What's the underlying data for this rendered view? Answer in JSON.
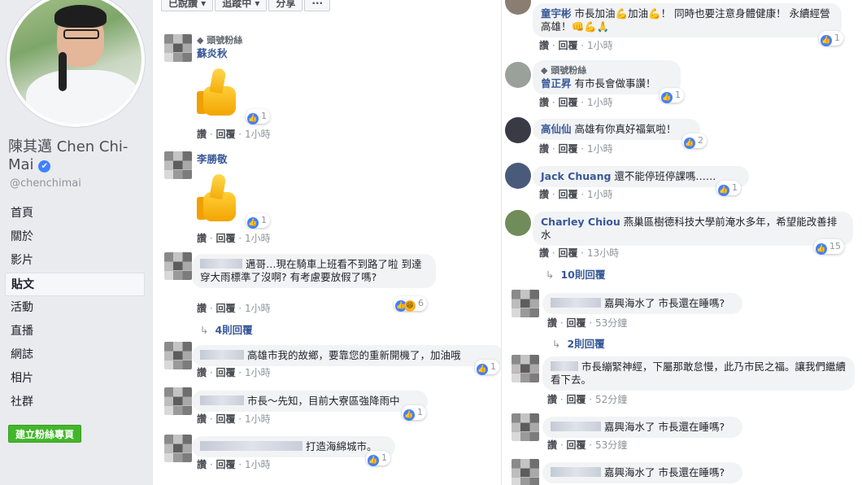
{
  "profile": {
    "name": "陳其邁 Chen Chi-Mai",
    "handle": "@chenchimai",
    "nav": [
      "首頁",
      "關於",
      "影片",
      "貼文",
      "活動",
      "直播",
      "網誌",
      "相片",
      "社群"
    ],
    "active_nav": "貼文",
    "create_page_label": "建立粉絲專頁"
  },
  "post_actions": [
    "已說讚 ▾",
    "追蹤中 ▾",
    "分享",
    "···"
  ],
  "labels": {
    "like": "讚",
    "reply": "回覆"
  },
  "left_comments": [
    {
      "badge": "頭號粉絲",
      "author": "蘇炎秋",
      "text": "",
      "sticker": true,
      "reactions": "1",
      "time": "1小時"
    },
    {
      "badge": "",
      "author": "李勝敬",
      "text": "",
      "sticker": true,
      "reactions": "1",
      "time": "1小時"
    },
    {
      "badge": "",
      "author": "",
      "text": "邁哥…現在騎車上班看不到路了啦 到達穿大雨標準了沒啊? 有考慮要放假了嗎?",
      "sticker": false,
      "reactions": "6",
      "time": "1小時",
      "replies": "4則回覆"
    },
    {
      "badge": "",
      "author": "",
      "text": "高雄市我的故鄉，要靠您的重新開機了，加油哦",
      "sticker": false,
      "reactions": "1",
      "time": "1小時"
    },
    {
      "badge": "",
      "author": "",
      "text": "市長～先知，目前大寮區強降雨中",
      "sticker": false,
      "reactions": "1",
      "time": "1小時"
    },
    {
      "badge": "",
      "author": "",
      "text": "打造海綿城市。",
      "sticker": false,
      "reactions": "1",
      "time": "1小時"
    }
  ],
  "right_comments": [
    {
      "badge": "",
      "author": "童宇彬",
      "text": "市長加油💪加油💪！ 同時也要注意身體健康！ 永續經營高雄！👊💪🙏",
      "reactions": "1",
      "time": "1小時"
    },
    {
      "badge": "頭號粉絲",
      "author": "曾正昇",
      "text": "有市長會做事讚！",
      "reactions": "1",
      "time": "1小時"
    },
    {
      "badge": "",
      "author": "高仙仙",
      "text": "高雄有你真好福氣啦！",
      "reactions": "2",
      "time": "1小時"
    },
    {
      "badge": "",
      "author": "Jack Chuang",
      "text": "還不能停班停課嗎……",
      "reactions": "1",
      "time": "1小時"
    },
    {
      "badge": "",
      "author": "Charley Chiou",
      "text": "燕巢區樹德科技大學前淹水多年，希望能改善排水",
      "reactions": "15",
      "time": "13小時",
      "replies": "10則回覆"
    }
  ],
  "right_replies": [
    {
      "text": "嘉興海水了 市長還在睡嗎?",
      "time": "53分鐘",
      "replies": "2則回覆"
    },
    {
      "text": "市長繃緊神經，下屬那敢怠慢，此乃市民之福。讓我們繼續看下去。",
      "time": "52分鐘"
    },
    {
      "text": "嘉興海水了 市長還在睡嗎?",
      "time": "53分鐘"
    },
    {
      "text": "嘉興海水了 市長還在睡嗎?",
      "time": ""
    }
  ],
  "colors": {
    "link": "#385898",
    "like": "#4080ff",
    "create_button": "#42b72a",
    "page_bg": "#e9ebee"
  },
  "icons": [
    "verified-icon",
    "like-icon",
    "haha-icon",
    "reply-arrow-icon",
    "thumbs-up-sticker"
  ]
}
